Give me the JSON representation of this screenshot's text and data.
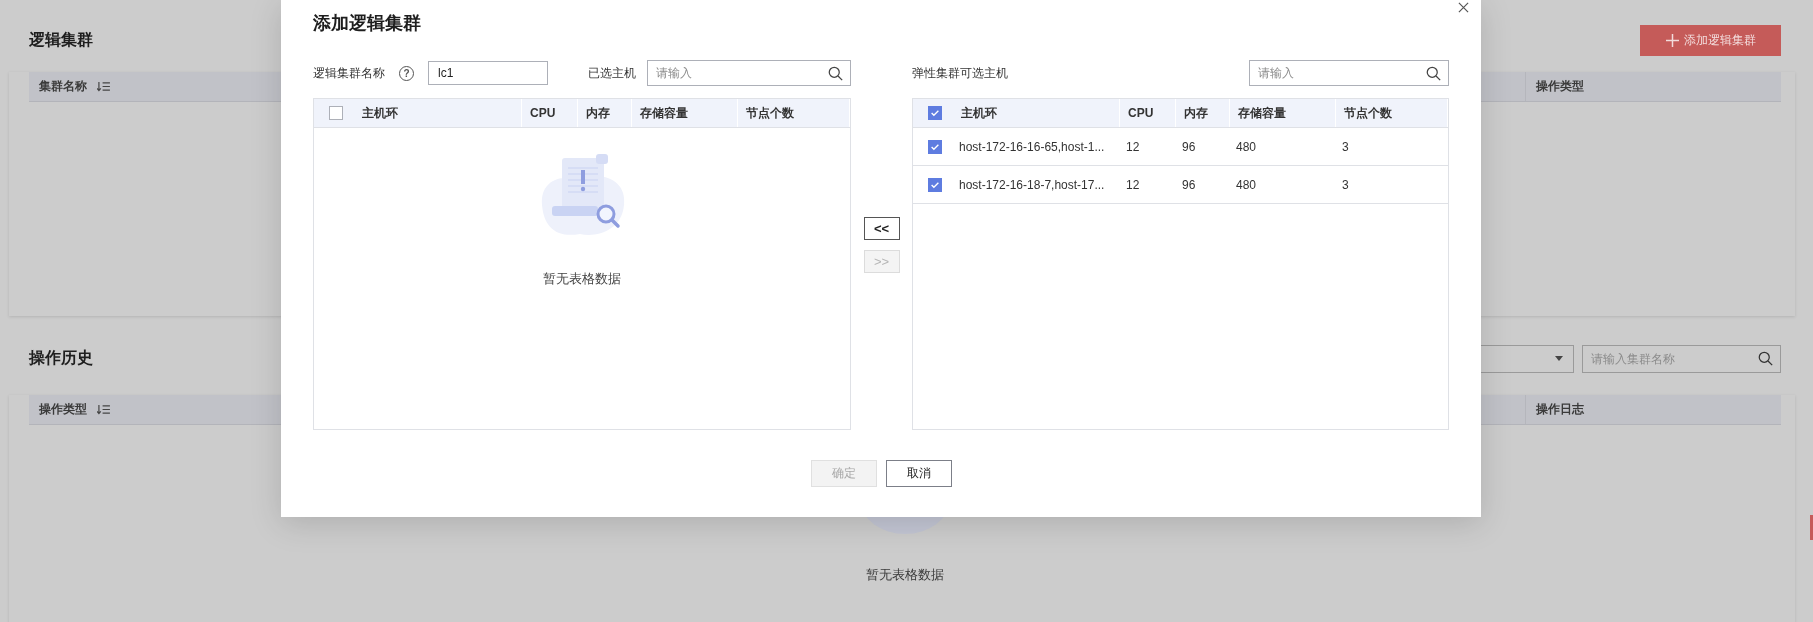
{
  "page": {
    "sections": [
      {
        "title": "逻辑集群",
        "button": {
          "label": "添加逻辑集群"
        },
        "columns": [
          {
            "label": "集群名称",
            "sortable": true
          },
          {
            "label": "操作类型",
            "sortable": false
          }
        ]
      },
      {
        "title": "操作历史",
        "search": {
          "placeholder": "请输入集群名称"
        },
        "columns": [
          {
            "label": "操作类型",
            "sortable": true
          },
          {
            "label": "操作日志",
            "sortable": false
          }
        ],
        "empty_text": "暂无表格数据"
      }
    ]
  },
  "modal": {
    "title": "添加逻辑集群",
    "name_field": {
      "label": "逻辑集群名称",
      "help": "?",
      "value": "lc1"
    },
    "panels": [
      {
        "label": "已选主机",
        "placeholder": "请输入",
        "all_checked": false,
        "columns": [
          "主机环",
          "CPU",
          "内存",
          "存储容量",
          "节点个数"
        ],
        "empty_text": "暂无表格数据"
      },
      {
        "label": "弹性集群可选主机",
        "placeholder": "请输入",
        "all_checked": true,
        "columns": [
          "主机环",
          "CPU",
          "内存",
          "存储容量",
          "节点个数"
        ],
        "rows": [
          {
            "checked": true,
            "cells": [
              "host-172-16-16-65,host-1...",
              "12",
              "96",
              "480",
              "3"
            ]
          },
          {
            "checked": true,
            "cells": [
              "host-172-16-18-7,host-17...",
              "12",
              "96",
              "480",
              "3"
            ]
          }
        ]
      }
    ],
    "transfer_buttons": [
      {
        "label": "<<",
        "disabled": false
      },
      {
        "label": ">>",
        "disabled": true
      }
    ],
    "footer_buttons": [
      {
        "label": "确定",
        "disabled": true
      },
      {
        "label": "取消",
        "disabled": false
      }
    ]
  }
}
